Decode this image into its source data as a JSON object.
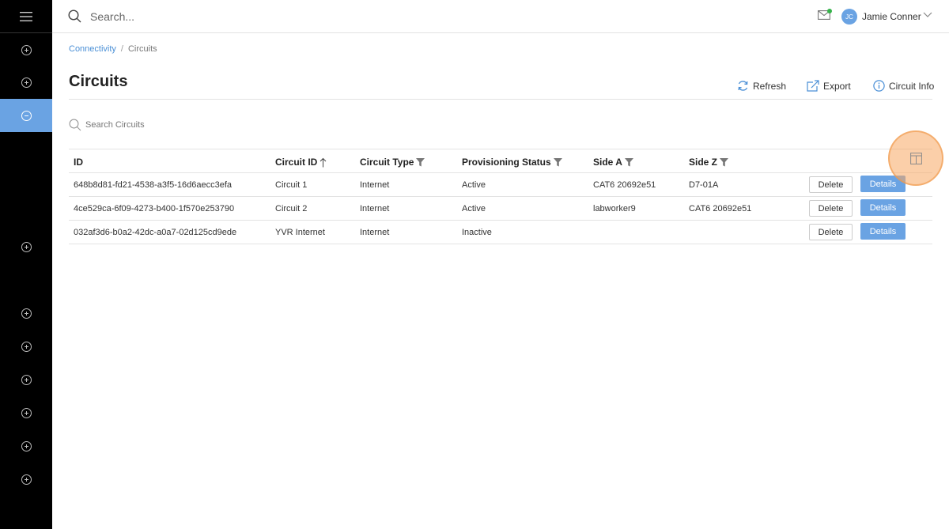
{
  "topbar": {
    "search_placeholder": "Search...",
    "user_initials": "JC",
    "user_name": "Jamie Conner"
  },
  "breadcrumb": {
    "parent": "Connectivity",
    "separator": "/",
    "current": "Circuits"
  },
  "page": {
    "title": "Circuits",
    "actions": {
      "refresh": "Refresh",
      "export": "Export",
      "circuit_info": "Circuit Info"
    },
    "search_placeholder": "Search Circuits"
  },
  "table": {
    "columns": {
      "id": "ID",
      "circuit_id": "Circuit ID",
      "circuit_type": "Circuit Type",
      "provisioning_status": "Provisioning Status",
      "side_a": "Side A",
      "side_z": "Side Z"
    },
    "rows": [
      {
        "id": "648b8d81-fd21-4538-a3f5-16d6aecc3efa",
        "circuit_id": "Circuit 1",
        "circuit_type": "Internet",
        "status": "Active",
        "side_a": "CAT6 20692e51",
        "side_z": "D7-01A"
      },
      {
        "id": "4ce529ca-6f09-4273-b400-1f570e253790",
        "circuit_id": "Circuit 2",
        "circuit_type": "Internet",
        "status": "Active",
        "side_a": "labworker9",
        "side_z": "CAT6 20692e51"
      },
      {
        "id": "032af3d6-b0a2-42dc-a0a7-02d125cd9ede",
        "circuit_id": "YVR Internet",
        "circuit_type": "Internet",
        "status": "Inactive",
        "side_a": "",
        "side_z": ""
      }
    ],
    "row_actions": {
      "delete": "Delete",
      "details": "Details"
    }
  },
  "icons": {
    "menu": "hamburger-icon",
    "search": "search-icon",
    "mail": "mail-icon",
    "chevron": "chevron-down-icon",
    "refresh": "refresh-icon",
    "export": "export-icon",
    "info": "info-icon",
    "filter": "filter-icon",
    "sort": "sort-ascending-icon",
    "columns": "columns-icon"
  },
  "colors": {
    "sidebar_bg": "#000000",
    "accent": "#6aa3e3",
    "link": "#4a8fd6",
    "highlight": "#f7a862",
    "online_dot": "#35b34a"
  }
}
